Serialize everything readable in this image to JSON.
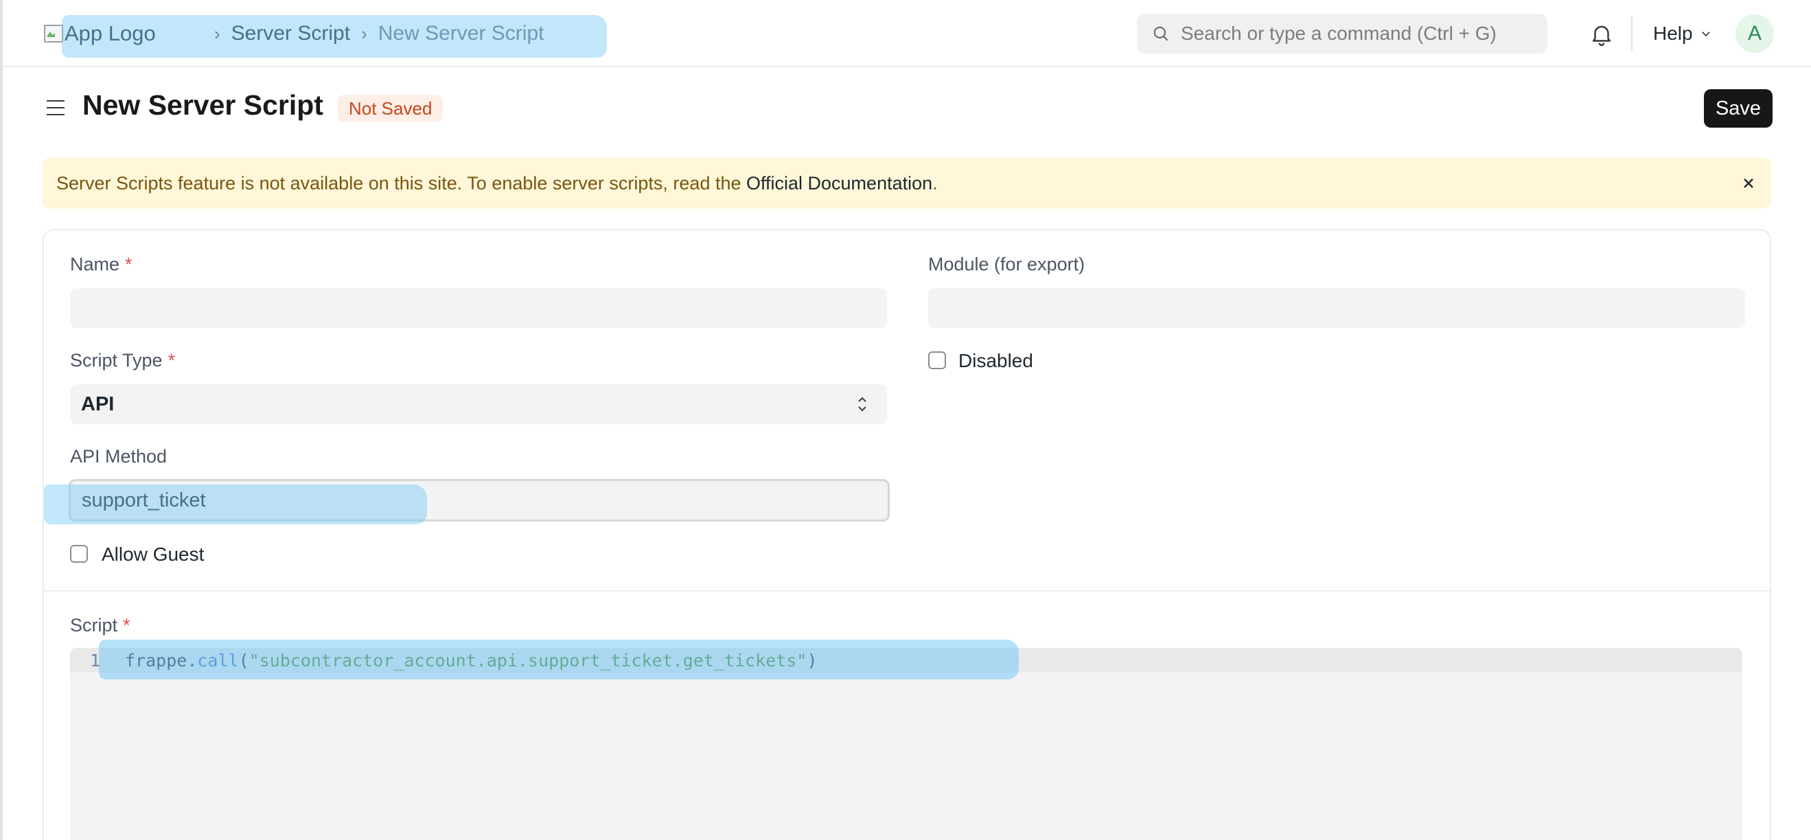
{
  "navbar": {
    "logo_alt": "App Logo",
    "breadcrumbs": [
      {
        "label": "Server Script"
      },
      {
        "label": "New Server Script"
      }
    ],
    "search_placeholder": "Search or type a command (Ctrl + G)",
    "help_label": "Help",
    "avatar_initial": "A"
  },
  "page": {
    "title": "New Server Script",
    "status": "Not Saved",
    "save_label": "Save"
  },
  "alert": {
    "text": "Server Scripts feature is not available on this site. To enable server scripts, read the ",
    "link_text": "Official Documentation",
    "suffix": "."
  },
  "form": {
    "name": {
      "label": "Name",
      "required_mark": "*",
      "value": ""
    },
    "module": {
      "label": "Module (for export)",
      "value": ""
    },
    "script_type": {
      "label": "Script Type",
      "required_mark": "*",
      "value": "API"
    },
    "disabled": {
      "label": "Disabled",
      "checked": false
    },
    "api_method": {
      "label": "API Method",
      "value": "support_ticket"
    },
    "allow_guest": {
      "label": "Allow Guest",
      "checked": false
    },
    "script": {
      "label": "Script",
      "required_mark": "*",
      "lines": [
        {
          "number": "1",
          "object": "frappe",
          "dot": ".",
          "function": "call",
          "open": "(",
          "string": "\"subcontractor_account.api.support_ticket.get_tickets\"",
          "close": ")"
        }
      ]
    }
  },
  "colors": {
    "accent_dark": "#171717",
    "status_text": "#c4491d",
    "status_bg": "#fdeee7",
    "alert_bg": "#fef7d9",
    "highlight": "#78c8f5",
    "required": "#e24c4c"
  },
  "icons": [
    "search-icon",
    "bell-icon",
    "chevron-down-icon",
    "hamburger-menu-icon",
    "close-icon",
    "select-arrows-icon",
    "broken-image-icon"
  ]
}
